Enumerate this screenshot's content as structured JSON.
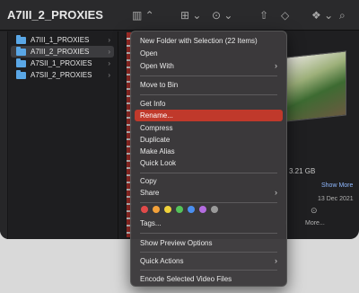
{
  "window": {
    "title": "A7III_2_PROXIES"
  },
  "toolbar": {
    "icons": [
      "columns-view-icon",
      "grid-group-icon",
      "more-actions-icon",
      "share-icon",
      "tag-icon",
      "dropbox-icon",
      "search-icon"
    ]
  },
  "folders": [
    {
      "label": "A7III_1_PROXIES",
      "selected": false
    },
    {
      "label": "A7III_2_PROXIES",
      "selected": true
    },
    {
      "label": "A7SII_1_PROXIES",
      "selected": false
    },
    {
      "label": "A7SII_2_PROXIES",
      "selected": false
    }
  ],
  "preview": {
    "size": "3.21 GB",
    "show_more": "Show More",
    "date": "13 Dec 2021",
    "more_label": "More..."
  },
  "context_menu": {
    "items": [
      {
        "label": "New Folder with Selection (22 Items)"
      },
      {
        "label": "Open"
      },
      {
        "label": "Open With",
        "submenu": true
      },
      {
        "label": "Move to Bin"
      },
      {
        "label": "Get Info"
      },
      {
        "label": "Rename...",
        "highlighted": true
      },
      {
        "label": "Compress"
      },
      {
        "label": "Duplicate"
      },
      {
        "label": "Make Alias"
      },
      {
        "label": "Quick Look"
      },
      {
        "label": "Copy"
      },
      {
        "label": "Share",
        "submenu": true
      },
      {
        "label": "Tags..."
      },
      {
        "label": "Show Preview Options"
      },
      {
        "label": "Quick Actions",
        "submenu": true
      },
      {
        "label": "Encode Selected Video Files"
      }
    ],
    "tag_colors": [
      "#e24a4a",
      "#f3a13a",
      "#f0d23a",
      "#54c35a",
      "#4a8ff0",
      "#b46ce0",
      "#9a9a9a"
    ]
  }
}
